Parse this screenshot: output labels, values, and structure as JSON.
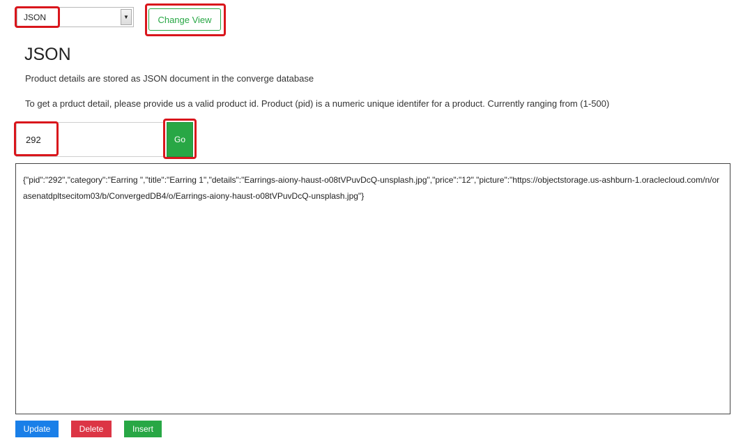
{
  "view_selector": {
    "selected": "JSON"
  },
  "change_view_label": "Change View",
  "title": "JSON",
  "description": "Product details are stored as JSON document in the converge database",
  "instructions": "To get a prduct detail, please provide us a valid product id. Product (pid) is a numeric unique identifer for a product. Currently ranging from (1-500)",
  "pid_input": {
    "value": "292"
  },
  "go_label": "Go",
  "json_output": "{\"pid\":\"292\",\"category\":\"Earring \",\"title\":\"Earring 1\",\"details\":\"Earrings-aiony-haust-o08tVPuvDcQ-unsplash.jpg\",\"price\":\"12\",\"picture\":\"https://objectstorage.us-ashburn-1.oraclecloud.com/n/orasenatdpltsecitom03/b/ConvergedDB4/o/Earrings-aiony-haust-o08tVPuvDcQ-unsplash.jpg\"}",
  "actions": {
    "update": "Update",
    "delete": "Delete",
    "insert": "Insert"
  },
  "colors": {
    "success": "#28a745",
    "primary": "#1a7fe8",
    "danger": "#dc3545",
    "highlight": "#d9161c"
  }
}
